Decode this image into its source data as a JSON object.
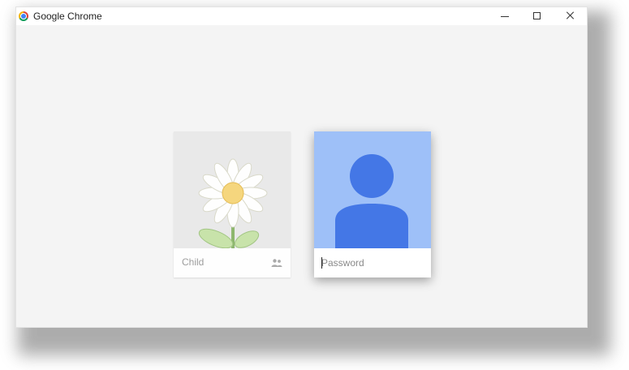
{
  "window": {
    "title": "Google Chrome"
  },
  "pods": {
    "child": {
      "name": "Child",
      "icon": "supervised-user-icon"
    },
    "focused": {
      "password_placeholder": "Password",
      "password_value": "",
      "avatar_icon": "default-person-avatar-icon"
    }
  },
  "colors": {
    "window_background": "#f4f4f4",
    "avatar_background": "#9ec0f8",
    "avatar_figure": "#4477e6",
    "child_background": "#e9e9e9"
  }
}
